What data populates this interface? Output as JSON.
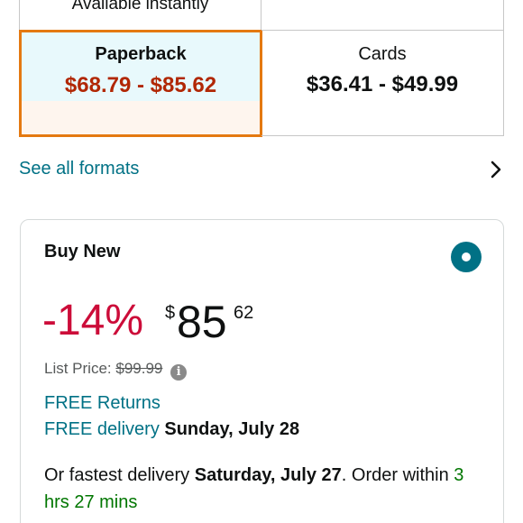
{
  "formats": {
    "top_left_label": "Available instantly",
    "selected": {
      "name": "Paperback",
      "price": "$68.79 - $85.62"
    },
    "other": {
      "name": "Cards",
      "price": "$36.41 - $49.99"
    }
  },
  "see_all": {
    "label": "See all formats",
    "icon": "chevron-right-icon"
  },
  "buy_box": {
    "title": "Buy New",
    "radio_selected": true,
    "discount": "-14%",
    "currency": "$",
    "price_whole": "85",
    "price_fraction": "62",
    "list_price_label": "List Price:",
    "list_price_value": "$99.99",
    "returns": "FREE Returns",
    "delivery_link": "FREE delivery",
    "delivery_date": "Sunday, July 28",
    "fastest_prefix": "Or fastest delivery",
    "fastest_date": "Saturday, July 27",
    "fastest_mid": ". Order within",
    "fastest_time": "3 hrs 27 mins"
  },
  "colors": {
    "accent_teal": "#007185",
    "selected_border": "#e47911",
    "price_red": "#b12704",
    "discount_red": "#cc0c39",
    "green": "#007600"
  }
}
